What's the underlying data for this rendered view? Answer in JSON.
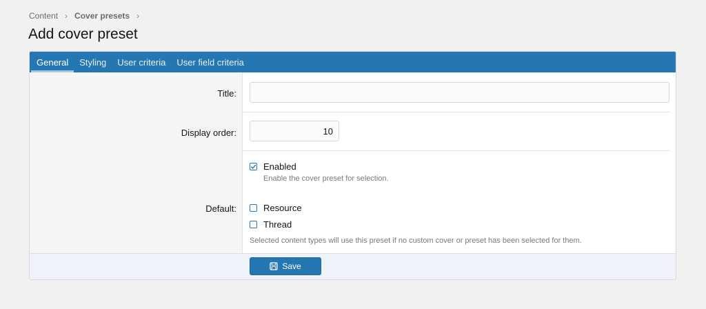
{
  "breadcrumb": {
    "items": [
      "Content",
      "Cover presets"
    ]
  },
  "page": {
    "title": "Add cover preset"
  },
  "tabs": [
    {
      "label": "General",
      "active": true
    },
    {
      "label": "Styling",
      "active": false
    },
    {
      "label": "User criteria",
      "active": false
    },
    {
      "label": "User field criteria",
      "active": false
    }
  ],
  "form": {
    "title_label": "Title:",
    "title_value": "",
    "display_order_label": "Display order:",
    "display_order_value": "10",
    "enabled_label": "Enabled",
    "enabled_checked": true,
    "enabled_hint": "Enable the cover preset for selection.",
    "default_label": "Default:",
    "default_options": [
      {
        "label": "Resource",
        "checked": false
      },
      {
        "label": "Thread",
        "checked": false
      }
    ],
    "default_hint": "Selected content types will use this preset if no custom cover or preset has been selected for them."
  },
  "footer": {
    "save_label": "Save"
  },
  "colors": {
    "accent": "#2577b1",
    "background": "#f1f1f2"
  }
}
